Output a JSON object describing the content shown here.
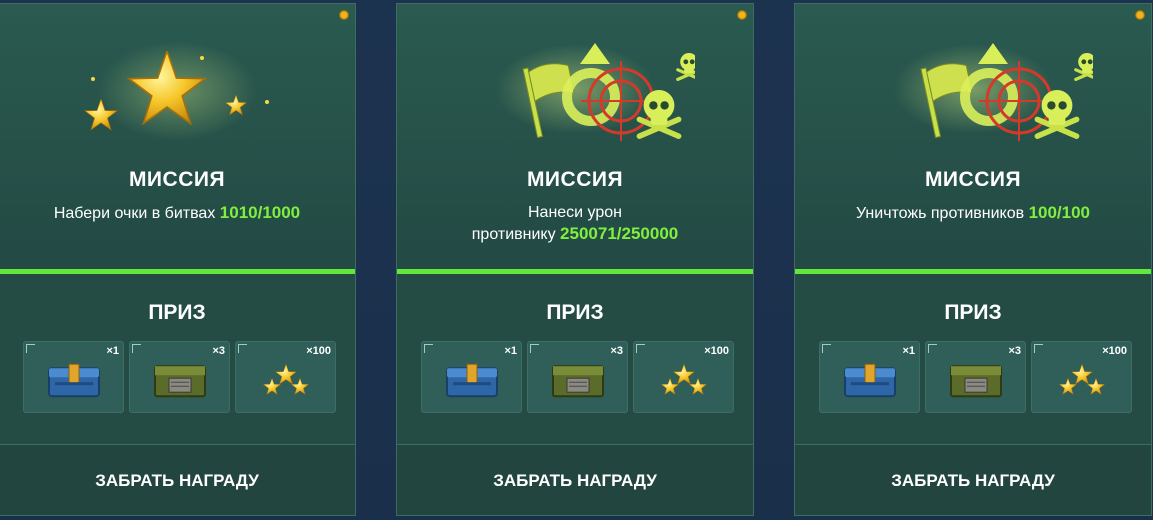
{
  "cards": [
    {
      "icon": "star-icon",
      "mission_title": "МИССИЯ",
      "desc_line1": "Набери очки в битвах",
      "desc_line2": "",
      "progress": "1010/1000",
      "prize_title": "ПРИЗ",
      "items": [
        {
          "icon": "blue-container-icon",
          "qty": "×1"
        },
        {
          "icon": "green-container-icon",
          "qty": "×3"
        },
        {
          "icon": "stars-icon",
          "qty": "×100"
        }
      ],
      "claim_label": "ЗАБРАТЬ НАГРАДУ"
    },
    {
      "icon": "flag-target-skull-icon",
      "mission_title": "МИССИЯ",
      "desc_line1": "Нанеси урон",
      "desc_line2": "противнику",
      "progress": "250071/250000",
      "prize_title": "ПРИЗ",
      "items": [
        {
          "icon": "blue-container-icon",
          "qty": "×1"
        },
        {
          "icon": "green-container-icon",
          "qty": "×3"
        },
        {
          "icon": "stars-icon",
          "qty": "×100"
        }
      ],
      "claim_label": "ЗАБРАТЬ НАГРАДУ"
    },
    {
      "icon": "flag-target-skull-icon",
      "mission_title": "МИССИЯ",
      "desc_line1": "Уничтожь противников",
      "desc_line2": "",
      "progress": "100/100",
      "prize_title": "ПРИЗ",
      "items": [
        {
          "icon": "blue-container-icon",
          "qty": "×1"
        },
        {
          "icon": "green-container-icon",
          "qty": "×3"
        },
        {
          "icon": "stars-icon",
          "qty": "×100"
        }
      ],
      "claim_label": "ЗАБРАТЬ НАГРАДУ"
    }
  ],
  "colors": {
    "progress": "#7ff040",
    "bar": "#61e83a",
    "notification_dot": "#f2b51c"
  }
}
